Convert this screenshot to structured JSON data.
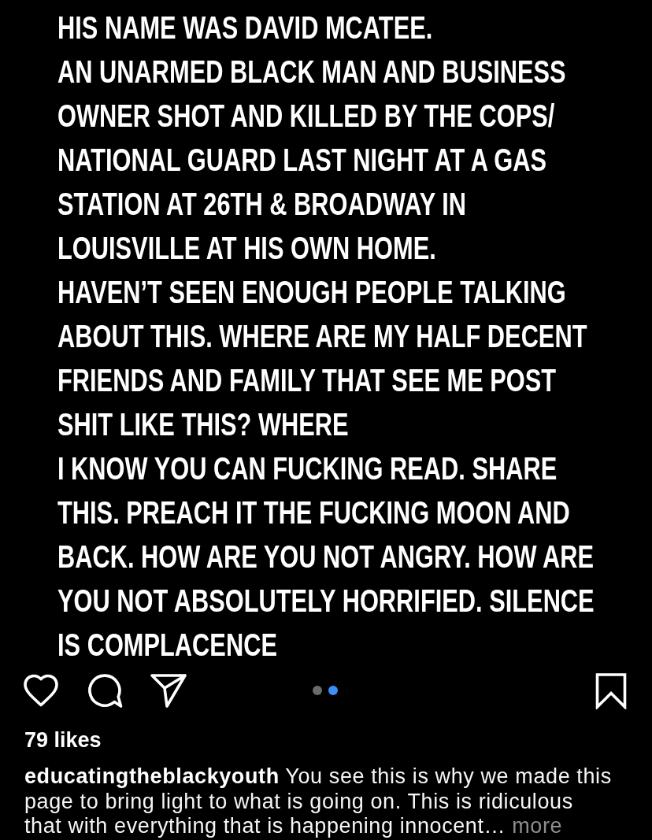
{
  "post_image": {
    "paragraphs": [
      "HIS NAME WAS DAVID MCATEE.",
      "AN UNARMED BLACK MAN AND BUSINESS\nOWNER SHOT AND KILLED BY THE COPS/\nNATIONAL GUARD LAST NIGHT AT A GAS\nSTATION AT 26TH & BROADWAY IN\nLOUISVILLE AT HIS OWN HOME.",
      "HAVEN’T SEEN ENOUGH PEOPLE TALKING\nABOUT THIS. WHERE ARE MY HALF DECENT\nFRIENDS AND FAMILY THAT SEE ME POST\nSHIT LIKE THIS? WHERE",
      "I KNOW YOU CAN FUCKING READ. SHARE\nTHIS. PREACH IT THE FUCKING MOON AND\nBACK. HOW ARE YOU NOT ANGRY. HOW ARE\nYOU NOT ABSOLUTELY HORRIFIED. SILENCE\nIS COMPLACENCE"
    ]
  },
  "actions": {
    "liked": false,
    "saved": false
  },
  "carousel": {
    "dots": [
      {
        "selected": false
      },
      {
        "selected": true
      }
    ]
  },
  "likes": "79 likes",
  "caption": {
    "username": "educatingtheblackyouth",
    "text": "You see this is why we made this page to bring light to what is going on. This is ridiculous that with everything that is happening innocent…",
    "more": "more"
  }
}
